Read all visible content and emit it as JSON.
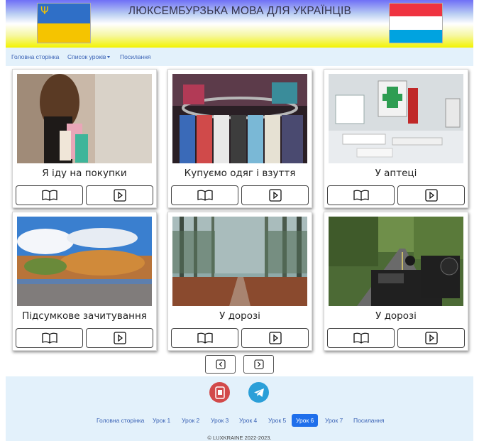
{
  "header": {
    "title": "ЛЮКСЕМБУРЗЬКА МОВА ДЛЯ УКРАЇНЦІВ",
    "flags": [
      "ukraine-flag",
      "luxembourg-flag"
    ]
  },
  "navbar": {
    "items": [
      "Головна сторінка",
      "Список уроків",
      "Посилання"
    ]
  },
  "lessons": [
    {
      "title": "Я іду на покупки",
      "image": "woman-with-shopping-bags"
    },
    {
      "title": "Купуємо одяг і взуття",
      "image": "clothes-rack"
    },
    {
      "title": "У аптеці",
      "image": "first-aid-kit"
    },
    {
      "title": "Підсумкове зачитування",
      "image": "riverside-autumn-town"
    },
    {
      "title": "У дорозі",
      "image": "forest-road"
    },
    {
      "title": "У дорозі",
      "image": "motorcycle-road"
    }
  ],
  "card_buttons": {
    "read_icon": "open-book-icon",
    "play_icon": "play-icon"
  },
  "pagination": {
    "prev_icon": "chevron-left-icon",
    "next_icon": "chevron-right-icon"
  },
  "footer": {
    "links": [
      "Головна сторінка",
      "Урок 1",
      "Урок 2",
      "Урок 3",
      "Урок 4",
      "Урок 5",
      "Урок 6",
      "Урок 7",
      "Посилання"
    ],
    "active_link": "Урок 6",
    "copyright": "© LUXKRAINE 2022-2023."
  },
  "colors": {
    "link": "#3a62b5",
    "active": "#1f6feb",
    "nav_bg": "#e3f1fb",
    "app_icon_bg": "#d24a4a",
    "telegram_bg": "#2b9fd8"
  }
}
